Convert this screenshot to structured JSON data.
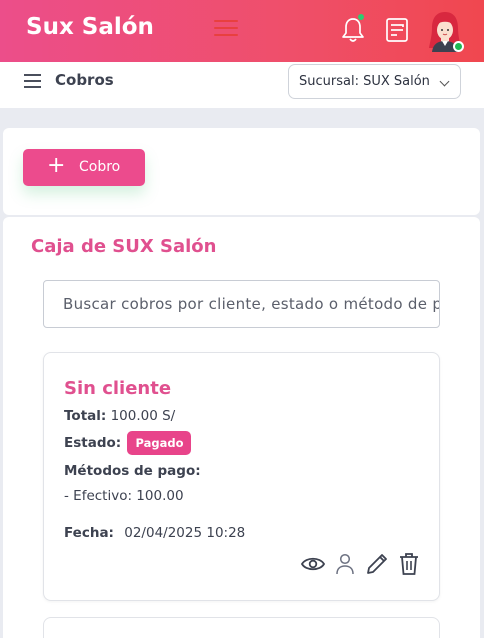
{
  "app": {
    "brand": "Sux Salón"
  },
  "header": {
    "icons": [
      "menu-icon",
      "bell-icon",
      "notes-icon",
      "avatar"
    ],
    "colors": {
      "gradient_start": "#ec4e8a",
      "gradient_end": "#f0474f"
    }
  },
  "subheader": {
    "title": "Cobros",
    "branch_select": {
      "value": "Sucursal: SUX Salón"
    }
  },
  "actions": {
    "new_button": {
      "icon": "+",
      "label": "Cobro"
    }
  },
  "main": {
    "title": "Caja de SUX Salón",
    "search": {
      "placeholder": "Buscar cobros por cliente, estado o método de pago"
    },
    "items": [
      {
        "client": "Sin cliente",
        "total_label": "Total:",
        "total_value": "100.00 S/",
        "status_label": "Estado:",
        "status_value": "Pagado",
        "methods_label": "Métodos de pago:",
        "method_line": "- Efectivo: 100.00",
        "date_label": "Fecha:",
        "date_value": "02/04/2025 10:28",
        "actions": [
          "eye-icon",
          "user-icon",
          "pencil-icon",
          "trash-icon"
        ]
      }
    ]
  },
  "colors": {
    "accent": "#e0508f",
    "badge": "#e8448a",
    "online": "#1db954"
  }
}
